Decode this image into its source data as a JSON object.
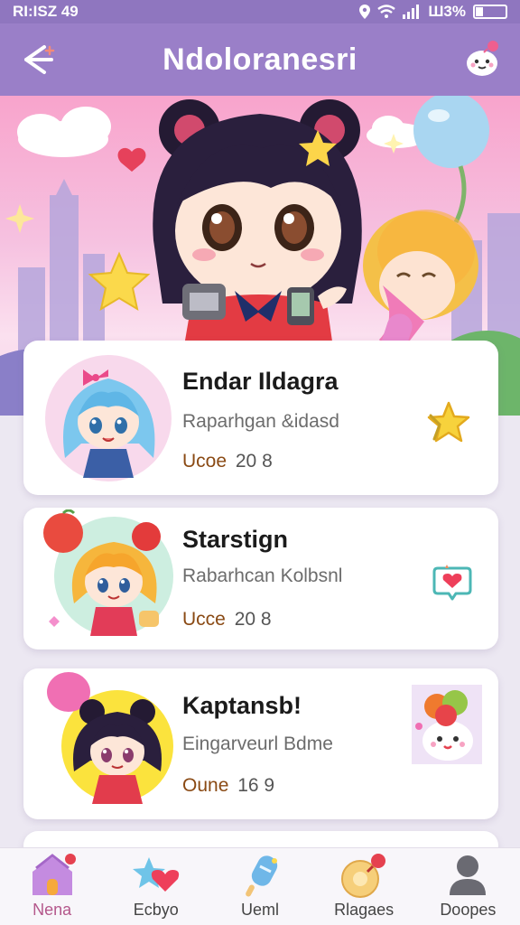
{
  "status_bar": {
    "time": "RI:ISZ 49",
    "battery": "Ш3%"
  },
  "app_bar": {
    "title": "Ndoloranesri"
  },
  "colors": {
    "app_bar": "#9a7fc8",
    "status_bar": "#8f76bf",
    "accent": "#b4578b",
    "meta_label": "#8a4a14"
  },
  "cards": [
    {
      "name": "Endar Ildagra",
      "subtitle": "Raparhgan &idasd",
      "meta_label": "Ucoe",
      "meta_value": "20 8",
      "avatar_icon": "blue-hair-girl-icon",
      "action_icon": "star-icon"
    },
    {
      "name": "Starstign",
      "subtitle": "Rabarhcan Kolbsnl",
      "meta_label": "Ucce",
      "meta_value": "20 8",
      "avatar_icon": "orange-hair-girl-icon",
      "action_icon": "heart-chat-icon"
    },
    {
      "name": "Kaptansb!",
      "subtitle": "Eingarveurl Bdme",
      "meta_label": "Oune",
      "meta_value": "16 9",
      "avatar_icon": "dark-hair-girl-icon",
      "action_icon": "snowman-icon"
    }
  ],
  "bottom_nav": [
    {
      "label": "Nena",
      "icon": "house-icon",
      "active": true
    },
    {
      "label": "Ecbyo",
      "icon": "hearts-icon",
      "active": false
    },
    {
      "label": "Ueml",
      "icon": "popsicle-icon",
      "active": false
    },
    {
      "label": "Rlagaes",
      "icon": "cookie-icon",
      "active": false
    },
    {
      "label": "Doopes",
      "icon": "person-icon",
      "active": false
    }
  ]
}
